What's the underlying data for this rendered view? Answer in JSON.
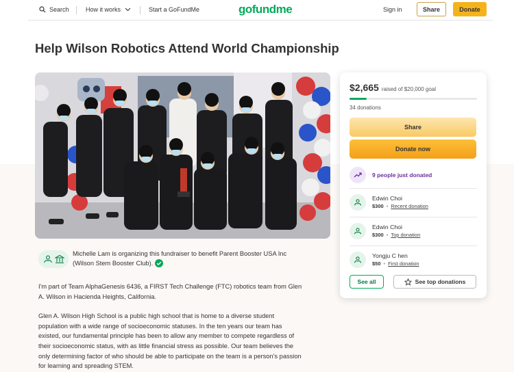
{
  "header": {
    "search_label": "Search",
    "how_it_works_label": "How it works",
    "start_label": "Start a GoFundMe",
    "logo_text": "gofundme",
    "signin_label": "Sign in",
    "share_label": "Share",
    "donate_label": "Donate"
  },
  "page": {
    "title": "Help Wilson Robotics Attend World Championship"
  },
  "organizer": {
    "text": "Michelle Lam is organizing this fundraiser to benefit Parent Booster USA Inc (Wilson Stem Booster Club)."
  },
  "story": {
    "paragraphs": [
      "I'm part of Team AlphaGenesis 6436, a FIRST Tech Challenge (FTC) robotics team from Glen A. Wilson in Hacienda Heights, California.",
      "Glen A. Wilson High School is a public high school that is home to a diverse student population with a wide range of socioeconomic statuses. In the ten years our team has existed, our fundamental principle has been to allow any member to compete regardless of their socioeconomic status, with as little financial stress as possible. Our team believes the only determining factor of who should be able to participate on the team is a person's passion for learning and spreading STEM."
    ]
  },
  "donation_panel": {
    "raised": "$2,665",
    "goal_text": "raised of $20,000 goal",
    "progress_fraction": 0.133,
    "donations_count": "34 donations",
    "share_label": "Share",
    "donate_now_label": "Donate now",
    "just_donated": "9 people just donated",
    "donors": [
      {
        "name": "Edwin Choi",
        "amount": "$300",
        "tag": "Recent donation"
      },
      {
        "name": "Edwin Choi",
        "amount": "$300",
        "tag": "Top donation"
      },
      {
        "name": "Yongju C hen",
        "amount": "$50",
        "tag": "First donation"
      }
    ],
    "see_all_label": "See all",
    "see_top_label": "See top donations"
  },
  "colors": {
    "brand_green": "#02a95c",
    "donate_orange": "#f5b31b",
    "trend_purple": "#6b2fa0"
  },
  "icons": [
    "search-icon",
    "chevron-down-icon",
    "trend-up-icon",
    "donor-hands-icon",
    "star-icon",
    "verified-check-icon",
    "bank-icon"
  ]
}
